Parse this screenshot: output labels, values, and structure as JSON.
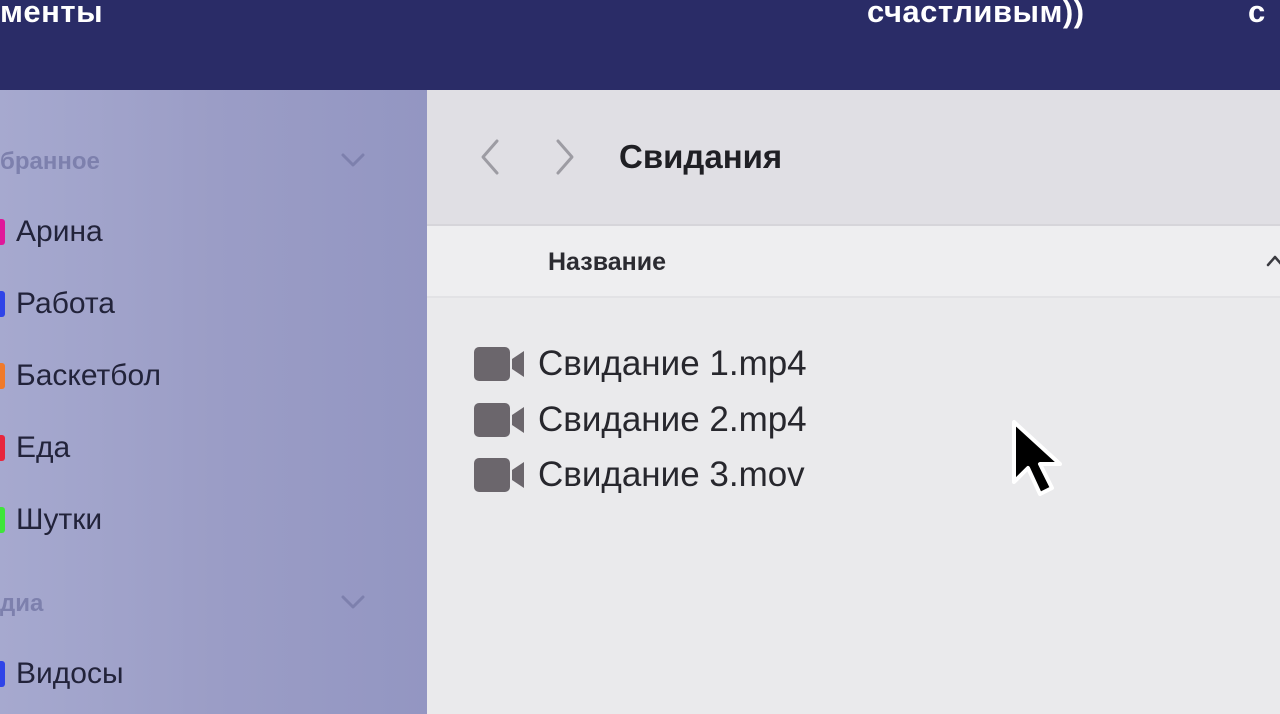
{
  "banner": {
    "left_text": "менты",
    "mid_text": "счастливым))",
    "right_text": "с"
  },
  "sidebar": {
    "favorites_title": "бранное",
    "tags": [
      {
        "label": "Арина",
        "color": "#e0189a"
      },
      {
        "label": "Работа",
        "color": "#2f44e8"
      },
      {
        "label": "Баскетбол",
        "color": "#f07a2a"
      },
      {
        "label": "Еда",
        "color": "#e8263c"
      },
      {
        "label": "Шутки",
        "color": "#3ee63a"
      }
    ],
    "media_title": "диа",
    "media_items": [
      {
        "label": "Видосы",
        "color": "#2f44e8"
      }
    ]
  },
  "finder": {
    "folder_title": "Свидания",
    "column_name": "Название",
    "files": [
      {
        "name": "Свидание 1.mp4",
        "icon": "video-camera-icon"
      },
      {
        "name": "Свидание 2.mp4",
        "icon": "video-camera-icon"
      },
      {
        "name": "Свидание 3.mov",
        "icon": "video-camera-icon"
      }
    ]
  },
  "icons": {
    "back": "chevron-left-icon",
    "forward": "chevron-right-icon",
    "section_toggle": "chevron-down-icon",
    "sort": "chevron-up-icon",
    "pointer": "mouse-pointer-icon"
  }
}
